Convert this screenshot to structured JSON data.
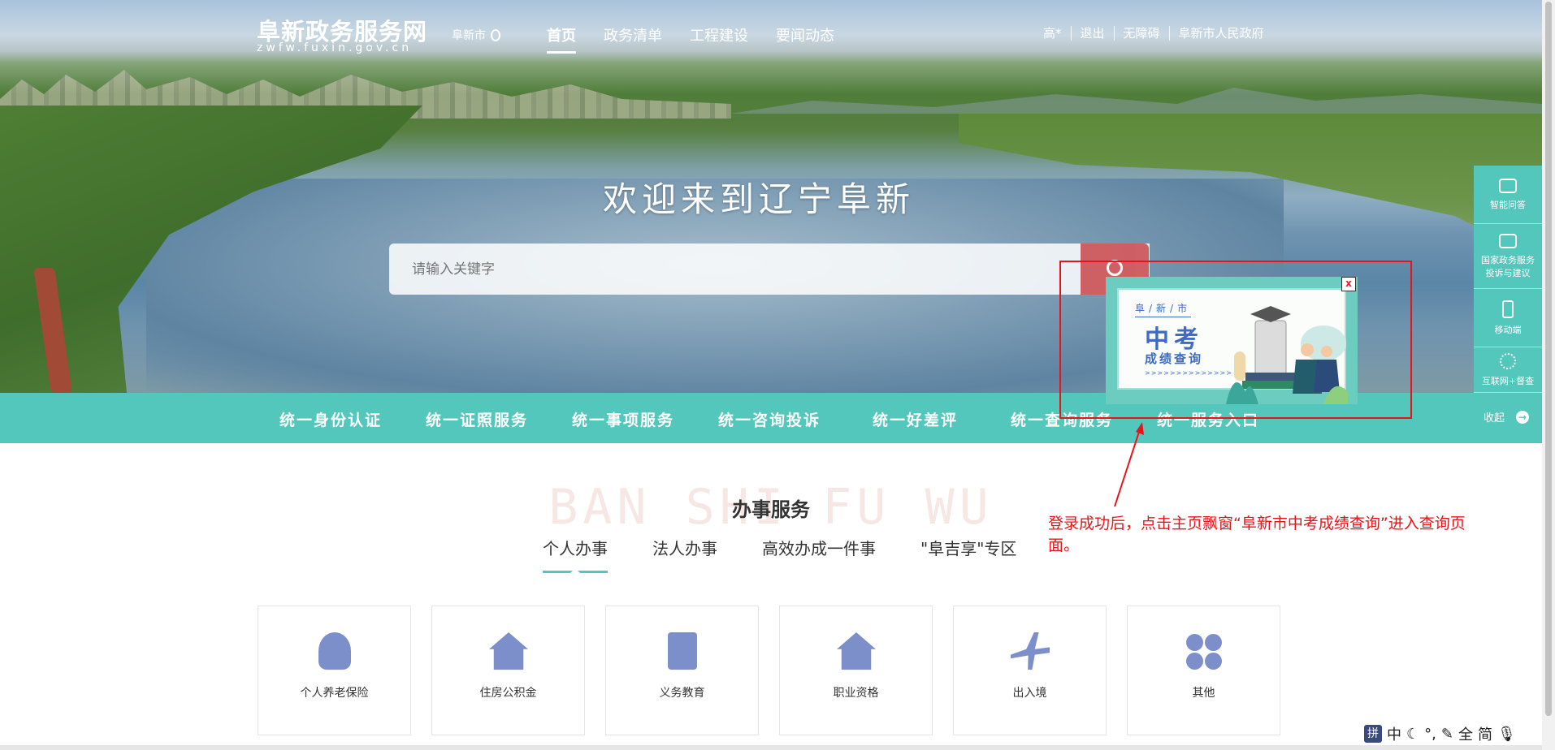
{
  "header": {
    "site_title": "阜新政务服务网",
    "site_subtitle": "zwfw.fuxin.gov.cn",
    "city": "阜新市",
    "nav": [
      "首页",
      "政务清单",
      "工程建设",
      "要闻动态"
    ],
    "user_links": [
      "高*",
      "退出",
      "无障碍",
      "阜新市人民政府"
    ]
  },
  "hero": {
    "welcome": "欢迎来到辽宁阜新",
    "search_placeholder": "请输入关键字"
  },
  "service_bar": [
    "统一身份认证",
    "统一证照服务",
    "统一事项服务",
    "统一咨询投诉",
    "统一好差评",
    "统一查询服务",
    "统一服务入口"
  ],
  "right_float": {
    "items": [
      "智能问答",
      "国家政务服务投诉与建议",
      "移动端",
      "互联网+督查"
    ],
    "collapse": "收起"
  },
  "popup": {
    "small": "阜/新/市",
    "big": "中考",
    "mid": "成绩查询",
    "chevrons": ">>>>>>>>>>>>>>",
    "close": "x"
  },
  "annotation": "登录成功后，点击主页飘窗“阜新市中考成绩查询”进入查询页面。",
  "services": {
    "bg_text": "BAN SHI FU WU",
    "title": "办事服务",
    "tabs": [
      "个人办事",
      "法人办事",
      "高效办成一件事",
      "\"阜吉享\"专区"
    ],
    "cards": [
      "个人养老保险",
      "住房公积金",
      "义务教育",
      "职业资格",
      "出入境",
      "其他"
    ]
  },
  "ime": [
    "拼",
    "中",
    "☾",
    "°,",
    "✎",
    "全",
    "简",
    "🎙"
  ],
  "colors": {
    "teal": "#54c7bc",
    "red": "#e8141b",
    "icon_blue": "#7c8fcb"
  }
}
